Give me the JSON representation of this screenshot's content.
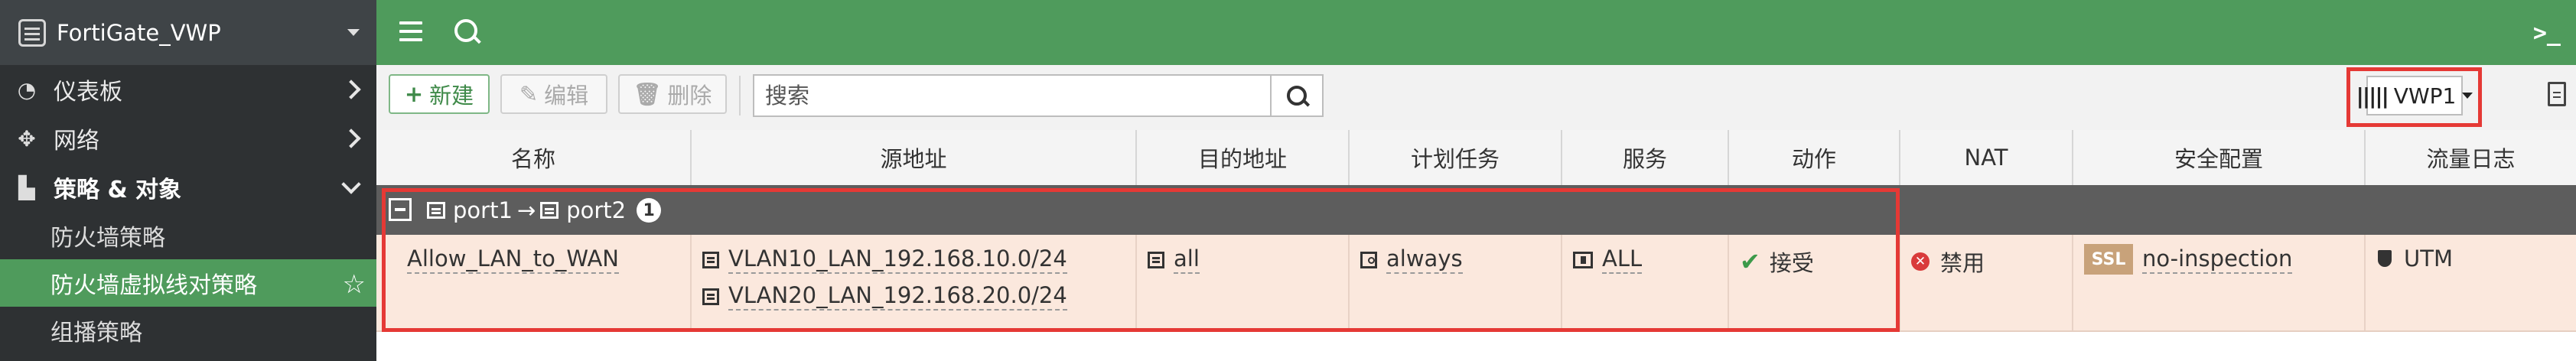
{
  "sidebar": {
    "device_name": "FortiGate_VWP",
    "items": [
      {
        "label": "仪表板",
        "icon": "dashboard-icon"
      },
      {
        "label": "网络",
        "icon": "network-icon"
      },
      {
        "label": "策略 & 对象",
        "icon": "policy-icon"
      }
    ],
    "sub_items": [
      {
        "label": "防火墙策略"
      },
      {
        "label": "防火墙虚拟线对策略",
        "active": true
      },
      {
        "label": "组播策略"
      }
    ]
  },
  "toolbar": {
    "new_label": "新建",
    "edit_label": "编辑",
    "delete_label": "删除",
    "search_placeholder": "搜索",
    "vwp_label": "VWP1"
  },
  "table": {
    "columns": [
      "名称",
      "源地址",
      "目的地址",
      "计划任务",
      "服务",
      "动作",
      "NAT",
      "安全配置",
      "流量日志"
    ],
    "group": {
      "from": "port1",
      "arrow": "→",
      "to": "port2",
      "count": "1"
    },
    "rows": [
      {
        "name": "Allow_LAN_to_WAN",
        "source": [
          "VLAN10_LAN_192.168.10.0/24",
          "VLAN20_LAN_192.168.20.0/24"
        ],
        "destination": "all",
        "schedule": "always",
        "service": "ALL",
        "action": "接受",
        "nat": "禁用",
        "security_badge": "SSL",
        "security": "no-inspection",
        "log": "UTM"
      }
    ]
  },
  "colors": {
    "accent_green": "#4f9b5c",
    "sidebar_bg": "#2e3133",
    "highlight_red": "#e53935",
    "row_bg": "#fbe8dd"
  }
}
